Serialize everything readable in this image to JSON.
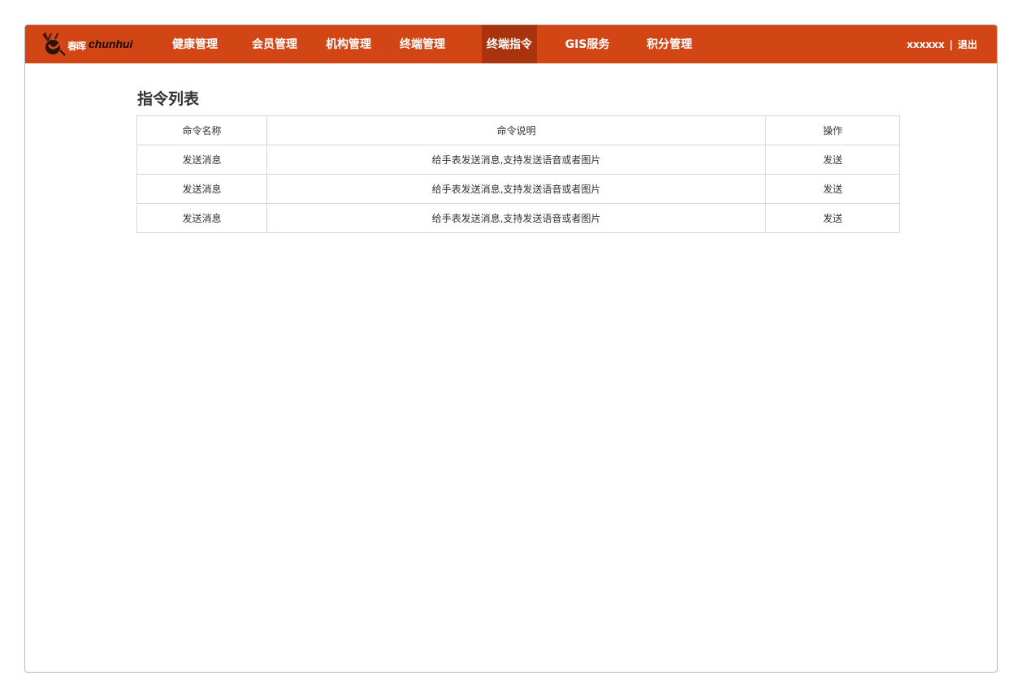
{
  "brand": {
    "name_cn": "春晖",
    "name_en": "chunhui",
    "logo_icon": "deer-logo-icon"
  },
  "nav": {
    "items": [
      {
        "label": "健康管理"
      },
      {
        "label": "会员管理"
      },
      {
        "label": "机构管理"
      },
      {
        "label": "终端管理"
      },
      {
        "label": "终端指令",
        "active": true
      },
      {
        "label": "GIS服务"
      },
      {
        "label": "积分管理"
      }
    ]
  },
  "user": {
    "name": "xxxxxx",
    "separator": "|",
    "logout_label": "退出"
  },
  "page": {
    "title": "指令列表"
  },
  "table": {
    "headers": [
      "命令名称",
      "命令说明",
      "操作"
    ],
    "rows": [
      {
        "name": "发送消息",
        "description": "给手表发送消息,支持发送语音或者图片",
        "action": "发送"
      },
      {
        "name": "发送消息",
        "description": "给手表发送消息,支持发送语音或者图片",
        "action": "发送"
      },
      {
        "name": "发送消息",
        "description": "给手表发送消息,支持发送语音或者图片",
        "action": "发送"
      }
    ]
  },
  "colors": {
    "header_bg": "#d24616",
    "nav_active_bg": "#a8330d",
    "border": "#d6d6d6"
  }
}
